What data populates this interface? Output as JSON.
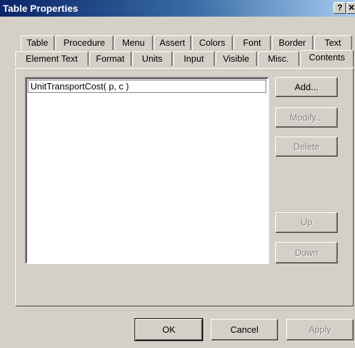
{
  "window": {
    "title": "Table Properties",
    "help_glyph": "?",
    "close_glyph": "✕"
  },
  "tabs_row1": [
    {
      "label": "Table"
    },
    {
      "label": "Procedure"
    },
    {
      "label": "Menu"
    },
    {
      "label": "Assert"
    },
    {
      "label": "Colors"
    },
    {
      "label": "Font"
    },
    {
      "label": "Border"
    },
    {
      "label": "Text"
    }
  ],
  "tabs_row2": [
    {
      "label": "Element Text"
    },
    {
      "label": "Format"
    },
    {
      "label": "Units"
    },
    {
      "label": "Input"
    },
    {
      "label": "Visible"
    },
    {
      "label": "Misc."
    },
    {
      "label": "Contents"
    }
  ],
  "active_tab": "Contents",
  "contents": {
    "items": [
      "UnitTransportCost( p, c )"
    ],
    "buttons": {
      "add": "Add...",
      "modify": "Modify...",
      "delete": "Delete",
      "up": "Up",
      "down": "Down"
    }
  },
  "footer": {
    "ok": "OK",
    "cancel": "Cancel",
    "apply": "Apply"
  }
}
